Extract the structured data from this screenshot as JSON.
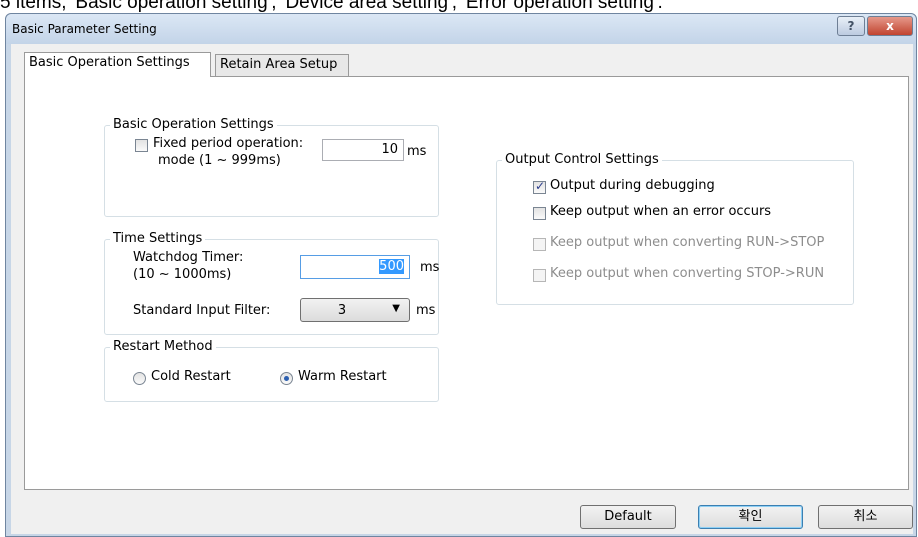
{
  "above_text": "5 items, 'Basic operation setting', 'Device area setting', 'Error operation setting'.",
  "window": {
    "title": "Basic Parameter Setting",
    "help_label": "?",
    "close_label": "x"
  },
  "tabs": [
    {
      "label": "Basic Operation Settings",
      "active": true
    },
    {
      "label": "Retain Area Setup",
      "active": false
    }
  ],
  "basic_operation": {
    "legend": "Basic Operation Settings",
    "fixed_period_label_line1": "Fixed period operation:",
    "fixed_period_label_line2": "mode (1 ~ 999ms)",
    "fixed_period_checked": false,
    "fixed_period_value": "10",
    "unit": "ms"
  },
  "time_settings": {
    "legend": "Time Settings",
    "watchdog_label_line1": "Watchdog Timer:",
    "watchdog_label_line2": "(10 ~ 1000ms)",
    "watchdog_value": "500",
    "watchdog_unit": "ms",
    "input_filter_label": "Standard Input Filter:",
    "input_filter_value": "3",
    "input_filter_unit": "ms"
  },
  "restart": {
    "legend": "Restart Method",
    "cold_label": "Cold Restart",
    "warm_label": "Warm Restart",
    "selected": "Warm Restart"
  },
  "output_control": {
    "legend": "Output Control Settings",
    "items": [
      {
        "label": "Output during debugging",
        "checked": true,
        "enabled": true
      },
      {
        "label": "Keep output when an error occurs",
        "checked": false,
        "enabled": true
      },
      {
        "label": "Keep output when converting RUN->STOP",
        "checked": false,
        "enabled": false
      },
      {
        "label": "Keep output when converting STOP->RUN",
        "checked": false,
        "enabled": false
      }
    ]
  },
  "buttons": {
    "default": "Default",
    "ok": "확인",
    "cancel": "취소"
  },
  "colors": {
    "titlebar": "#c3d4e8",
    "close": "#c1442f",
    "focus_border": "#569de5",
    "selection": "#3399ff"
  },
  "icons": {
    "help": "question-icon",
    "close": "close-icon",
    "combo_arrow": "chevron-down-icon",
    "check": "check-icon"
  }
}
